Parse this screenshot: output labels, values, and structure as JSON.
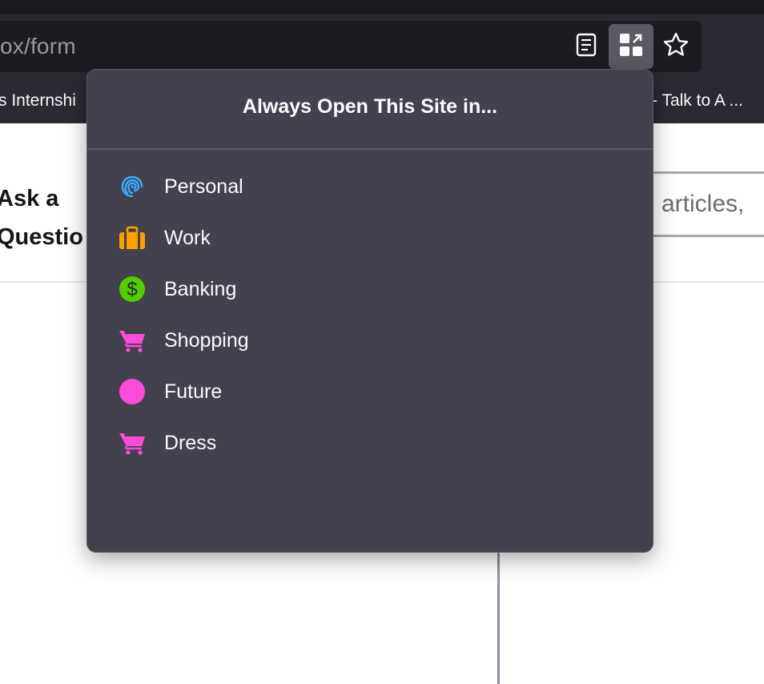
{
  "browser": {
    "url_fragment": "ox/form",
    "bookmarks": [
      "s Internshi",
      "- Talk to A ..."
    ]
  },
  "page": {
    "title_line1": "Ask a",
    "title_line2": "Questio",
    "search_placeholder": "articles,"
  },
  "popup": {
    "title": "Always Open This Site in...",
    "containers": [
      {
        "label": "Personal",
        "icon": "fingerprint-icon",
        "color": "#37adff"
      },
      {
        "label": "Work",
        "icon": "briefcase-icon",
        "color": "#ff9f00"
      },
      {
        "label": "Banking",
        "icon": "dollar-icon",
        "color": "#51cd00"
      },
      {
        "label": "Shopping",
        "icon": "cart-icon",
        "color": "#ff4bda"
      },
      {
        "label": "Future",
        "icon": "circle-icon",
        "color": "#ff4bda"
      },
      {
        "label": "Dress",
        "icon": "cart-icon",
        "color": "#ff4bda"
      }
    ]
  }
}
